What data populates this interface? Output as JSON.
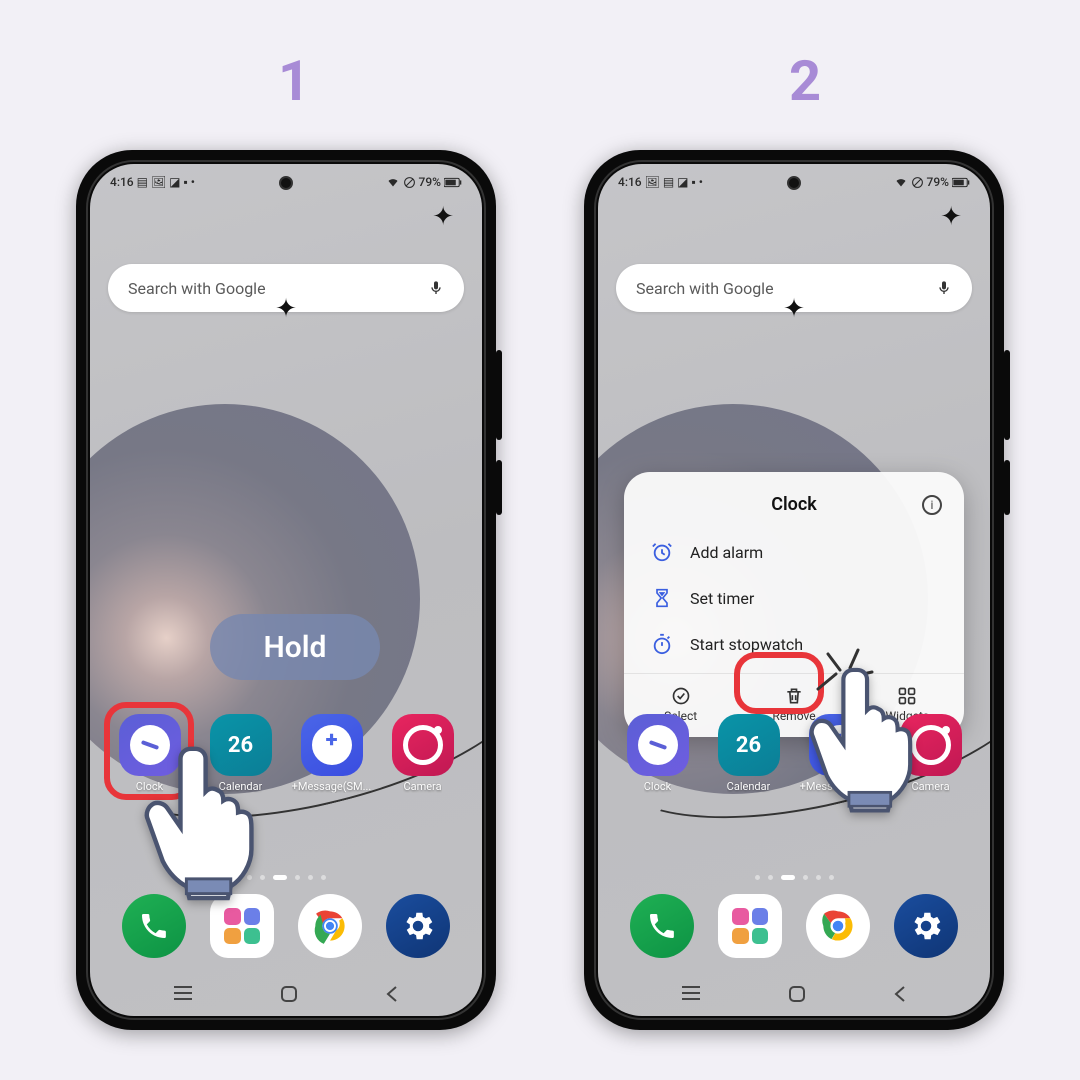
{
  "steps": {
    "one": "1",
    "two": "2"
  },
  "status": {
    "time": "4:16",
    "battery": "79%"
  },
  "search": {
    "placeholder": "Search with Google"
  },
  "overlay": {
    "hold": "Hold"
  },
  "apps": {
    "clock": "Clock",
    "calendar": "Calendar",
    "calendar_day": "26",
    "message": "+Message(SM...",
    "camera": "Camera"
  },
  "popup": {
    "title": "Clock",
    "rows": {
      "add_alarm": "Add alarm",
      "set_timer": "Set timer",
      "start_stopwatch": "Start stopwatch"
    },
    "actions": {
      "select": "Select",
      "remove": "Remove",
      "widgets": "Widgets"
    }
  }
}
